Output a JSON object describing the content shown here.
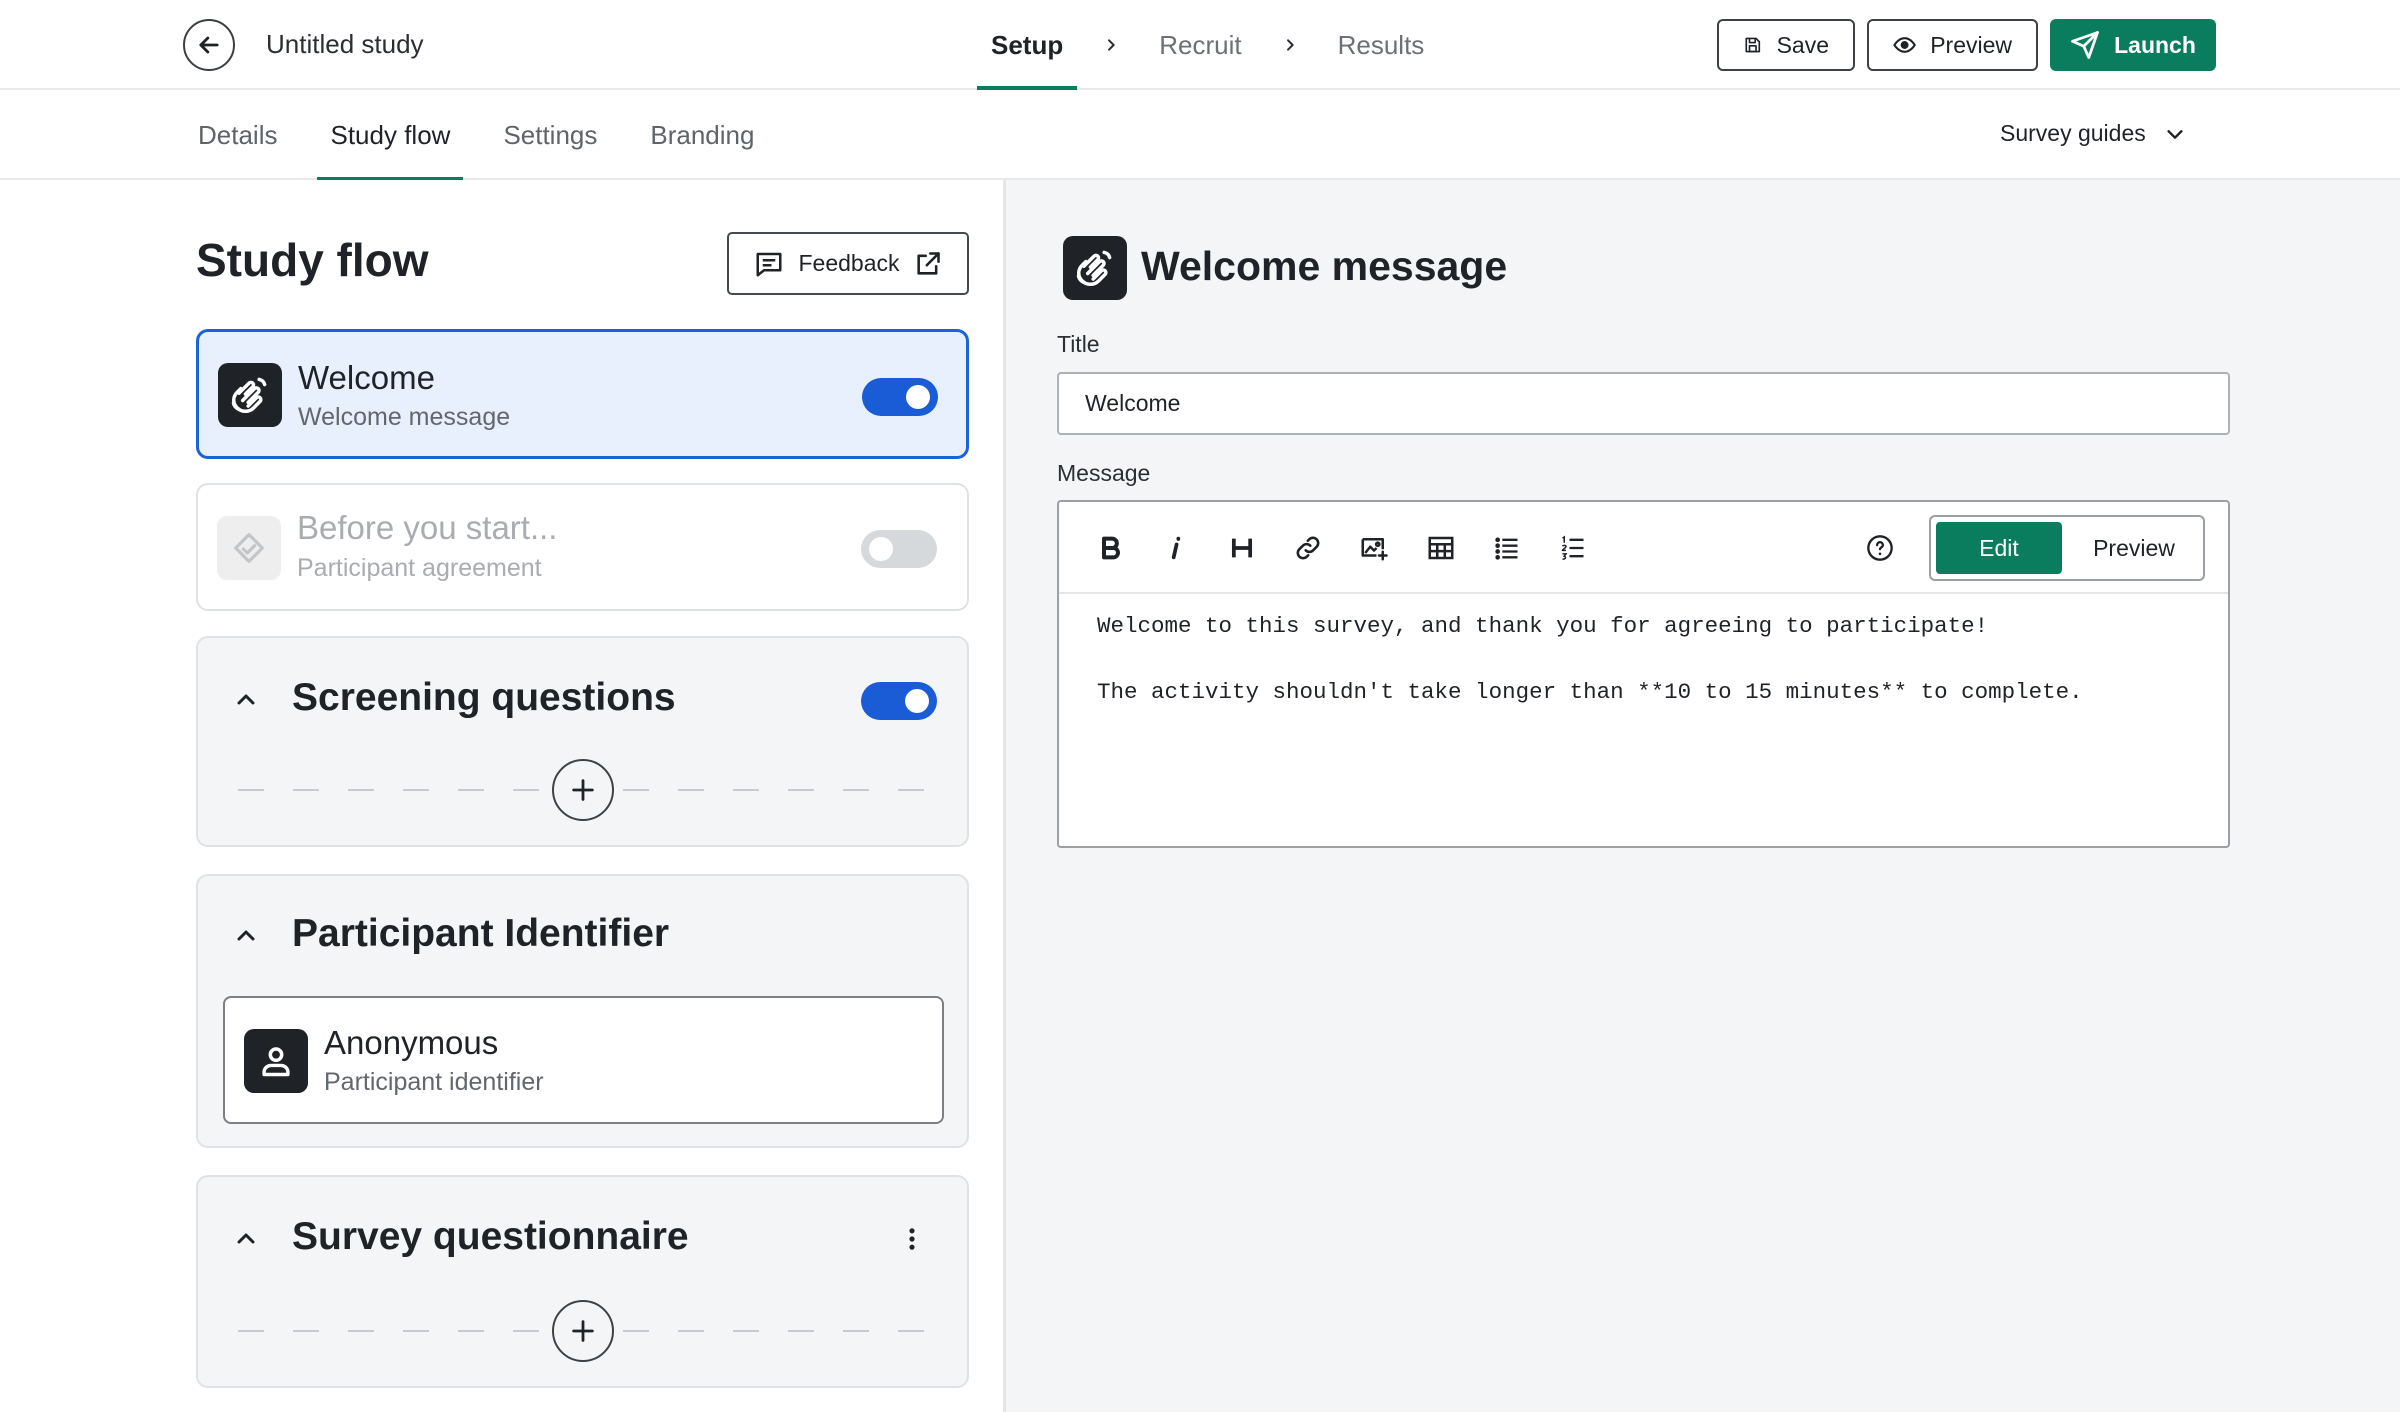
{
  "header": {
    "study_name": "Untitled study",
    "steps": [
      {
        "label": "Setup",
        "active": true
      },
      {
        "label": "Recruit",
        "active": false
      },
      {
        "label": "Results",
        "active": false
      }
    ],
    "save_label": "Save",
    "preview_label": "Preview",
    "launch_label": "Launch"
  },
  "subnav": {
    "tabs": [
      {
        "label": "Details",
        "active": false
      },
      {
        "label": "Study flow",
        "active": true
      },
      {
        "label": "Settings",
        "active": false
      },
      {
        "label": "Branding",
        "active": false
      }
    ],
    "guides_label": "Survey guides"
  },
  "flow": {
    "title": "Study flow",
    "feedback_label": "Feedback",
    "welcome": {
      "title": "Welcome",
      "subtitle": "Welcome message",
      "enabled": true
    },
    "before_start": {
      "title": "Before you start...",
      "subtitle": "Participant agreement",
      "enabled": false
    },
    "screening": {
      "title": "Screening questions",
      "enabled": true
    },
    "identifier": {
      "title": "Participant Identifier",
      "item_title": "Anonymous",
      "item_subtitle": "Participant identifier"
    },
    "survey": {
      "title": "Survey questionnaire"
    }
  },
  "editor": {
    "heading": "Welcome message",
    "title_label": "Title",
    "title_value": "Welcome",
    "message_label": "Message",
    "mode_edit": "Edit",
    "mode_preview": "Preview",
    "message_lines": [
      "Welcome to this survey, and thank you for agreeing to participate!",
      "",
      "The activity shouldn't take longer than **10 to 15 minutes** to complete."
    ]
  },
  "colors": {
    "brand_green": "#0b7d5f",
    "toggle_blue": "#1a5bd6",
    "selected_bg": "#e7f0fc",
    "panel_bg": "#f3f5f6"
  }
}
